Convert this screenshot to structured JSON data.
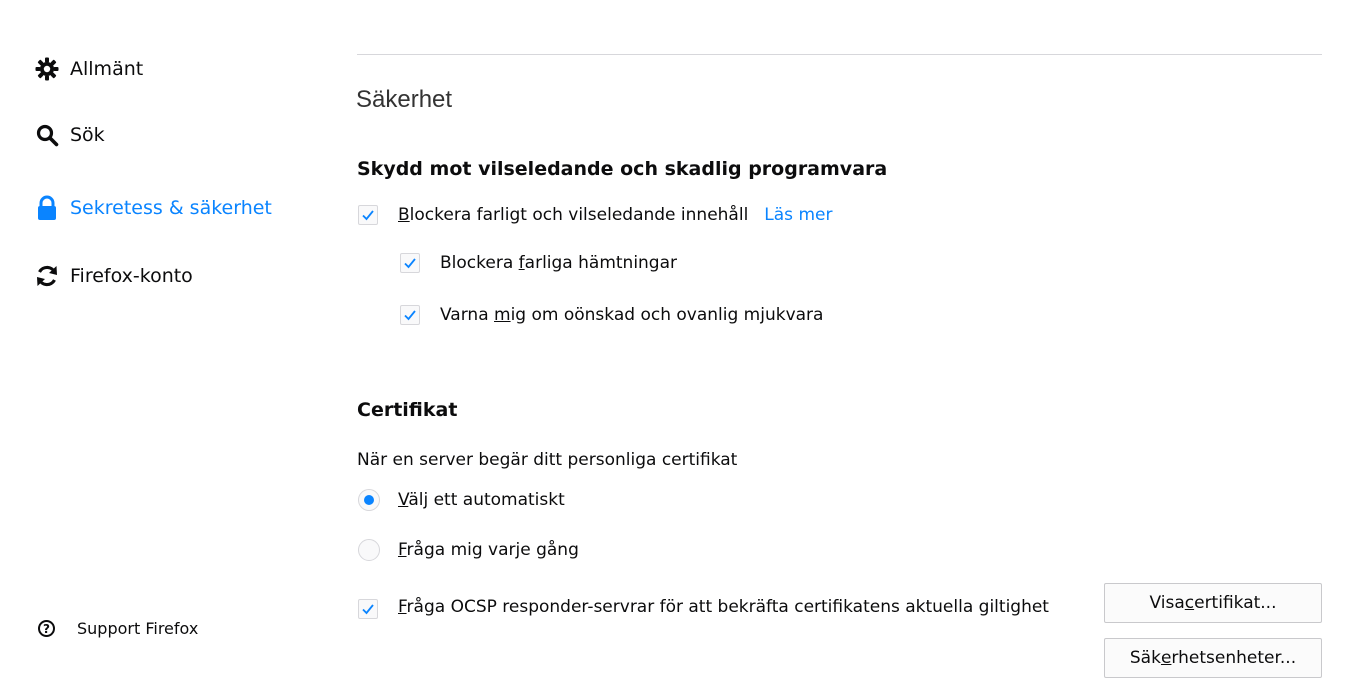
{
  "sidebar": {
    "items": [
      {
        "label": "Allmänt",
        "icon": "gear-icon"
      },
      {
        "label": "Sök",
        "icon": "search-icon"
      },
      {
        "label": "Sekretess & säkerhet",
        "icon": "lock-icon",
        "selected": true
      },
      {
        "label": "Firefox-konto",
        "icon": "sync-icon"
      }
    ],
    "support_label": "Support Firefox"
  },
  "main": {
    "section_title": "Säkerhet",
    "protection": {
      "heading": "Skydd mot vilseledande och skadlig programvara",
      "block_dangerous": {
        "pre": "",
        "accel": "B",
        "post": "lockera farligt och vilseledande innehåll",
        "checked": true
      },
      "learn_more": "Läs mer",
      "block_downloads": {
        "pre": "Blockera ",
        "accel": "f",
        "post": "arliga hämtningar",
        "checked": true
      },
      "warn_unwanted": {
        "pre": "Varna ",
        "accel": "m",
        "post": "ig om oönskad och ovanlig mjukvara",
        "checked": true
      }
    },
    "certificates": {
      "heading": "Certifikat",
      "description": "När en server begär ditt personliga certifikat",
      "select_auto": {
        "accel": "V",
        "post": "älj ett automatiskt",
        "selected": true
      },
      "ask_every": {
        "accel": "F",
        "post": "råga mig varje gång",
        "selected": false
      },
      "ocsp": {
        "accel": "F",
        "post": "råga OCSP responder-servrar för att bekräfta certifikatens aktuella giltighet",
        "checked": true
      },
      "view_certs": {
        "pre": "Visa ",
        "accel": "c",
        "post": "ertifikat..."
      },
      "security_devices": {
        "pre": "Säk",
        "accel": "e",
        "post": "rhetsenheter..."
      }
    }
  },
  "colors": {
    "accent": "#0a84ff",
    "text": "#0c0c0d",
    "border": "#d7d7db"
  }
}
